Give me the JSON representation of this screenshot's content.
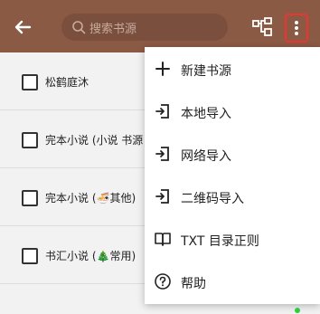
{
  "search": {
    "placeholder": "搜索书源"
  },
  "list": {
    "items": [
      {
        "label": "松鹤庭沐"
      },
      {
        "label": "完本小说 (小说 书源"
      },
      {
        "label": "完本小说 (🍜其他)"
      },
      {
        "label": "书汇小说 (🎄常用)"
      }
    ]
  },
  "menu": {
    "items": [
      {
        "label": "新建书源",
        "icon": "plus-icon"
      },
      {
        "label": "本地导入",
        "icon": "import-icon"
      },
      {
        "label": "网络导入",
        "icon": "import-icon"
      },
      {
        "label": "二维码导入",
        "icon": "import-icon"
      },
      {
        "label": "TXT 目录正则",
        "icon": "book-icon"
      },
      {
        "label": "帮助",
        "icon": "help-icon"
      }
    ]
  },
  "colors": {
    "toolbar": "#8a5a45",
    "highlight": "#e33333",
    "status": "#2ecc40"
  }
}
